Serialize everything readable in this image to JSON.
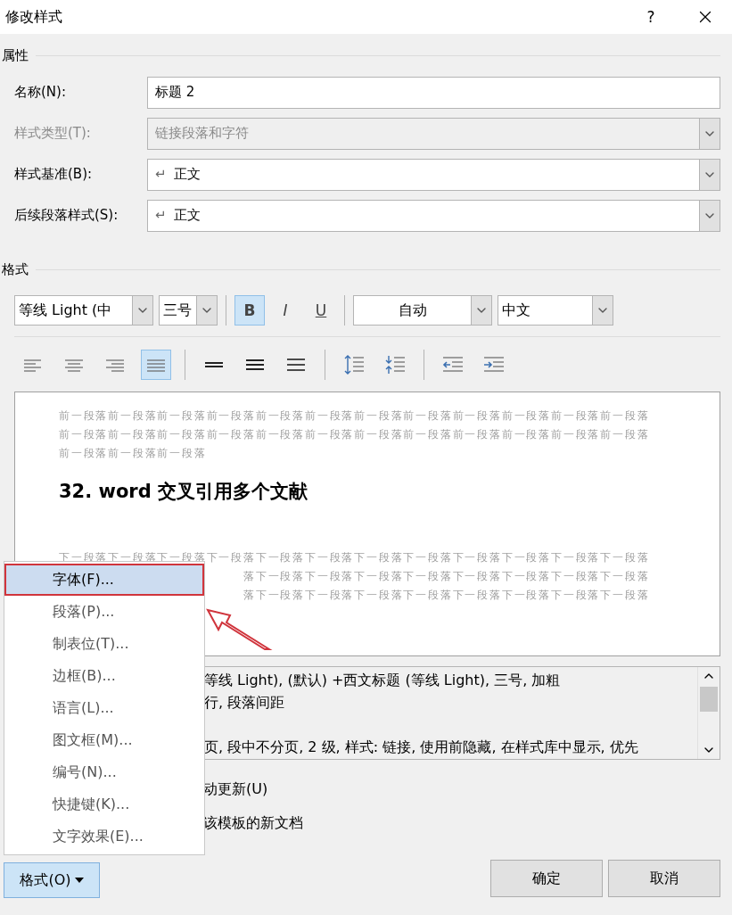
{
  "window": {
    "title": "修改样式",
    "help": "?"
  },
  "properties": {
    "heading": "属性",
    "fields": [
      {
        "label": "名称(N):",
        "value": "标题 2",
        "kind": "text",
        "disabled": false
      },
      {
        "label": "样式类型(T):",
        "value": "链接段落和字符",
        "kind": "combo",
        "disabled": true
      },
      {
        "label": "样式基准(B):",
        "prefix": "↵",
        "value": "正文",
        "kind": "combo",
        "disabled": false
      },
      {
        "label": "后续段落样式(S):",
        "prefix": "↵",
        "value": "正文",
        "kind": "combo",
        "disabled": false
      }
    ]
  },
  "format": {
    "heading": "格式",
    "font": "等线 Light (中",
    "size": "三号",
    "font_color_label": "自动",
    "script": "中文",
    "styles": [
      {
        "label": "B",
        "kind": "bold",
        "selected": true
      },
      {
        "label": "I",
        "kind": "italic",
        "selected": false
      },
      {
        "label": "U",
        "kind": "underline",
        "selected": false
      }
    ],
    "paragraph_tools": [
      {
        "kind": "align-left",
        "selected": false
      },
      {
        "kind": "align-center",
        "selected": false
      },
      {
        "kind": "align-right",
        "selected": false
      },
      {
        "kind": "justify",
        "selected": true
      },
      {
        "kind": "single-spacing",
        "selected": false
      },
      {
        "kind": "one-half-spacing",
        "selected": false
      },
      {
        "kind": "double-spacing",
        "selected": false
      },
      {
        "kind": "space-increase",
        "selected": false
      },
      {
        "kind": "space-decrease",
        "selected": false
      },
      {
        "kind": "indent-decrease",
        "selected": false
      },
      {
        "kind": "indent-increase",
        "selected": false
      }
    ]
  },
  "preview": {
    "before": [
      "前一段落前一段落前一段落前一段落前一段落前一段落前一段落前一段落前一段落前一段落前一段落前一段落",
      "前一段落前一段落前一段落前一段落前一段落前一段落前一段落前一段落前一段落前一段落前一段落前一段落",
      "前一段落前一段落前一段落"
    ],
    "heading": "32. word 交叉引用多个文献",
    "after": [
      "下一段落下一段落下一段落下一段落下一段落下一段落下一段落下一段落下一段落下一段落下一段落下一段落",
      "落下一段落下一段落下一段落下一段落下一段落下一段落下一段落下一段落",
      "落下一段落下一段落下一段落下一段落下一段落下一段落下一段落下一段落"
    ]
  },
  "description": {
    "lines": [
      "等线 Light), (默认) +西文标题 (等线 Light), 三号, 加粗",
      "行, 段落间距",
      "页, 段中不分页, 2 级, 样式: 链接, 使用前隐藏, 在样式库中显示, 优先"
    ]
  },
  "options": [
    "动更新(U)",
    "该模板的新文档"
  ],
  "format_menu": {
    "items": [
      {
        "label": "字体(F)...",
        "selected": true
      },
      {
        "label": "段落(P)...",
        "selected": false
      },
      {
        "label": "制表位(T)...",
        "selected": false
      },
      {
        "label": "边框(B)...",
        "selected": false
      },
      {
        "label": "语言(L)...",
        "selected": false
      },
      {
        "label": "图文框(M)...",
        "selected": false
      },
      {
        "label": "编号(N)...",
        "selected": false
      },
      {
        "label": "快捷键(K)...",
        "selected": false
      },
      {
        "label": "文字效果(E)...",
        "selected": false
      }
    ]
  },
  "format_button": {
    "label": "格式(O)",
    "open": true
  },
  "buttons": [
    "确定",
    "取消"
  ]
}
